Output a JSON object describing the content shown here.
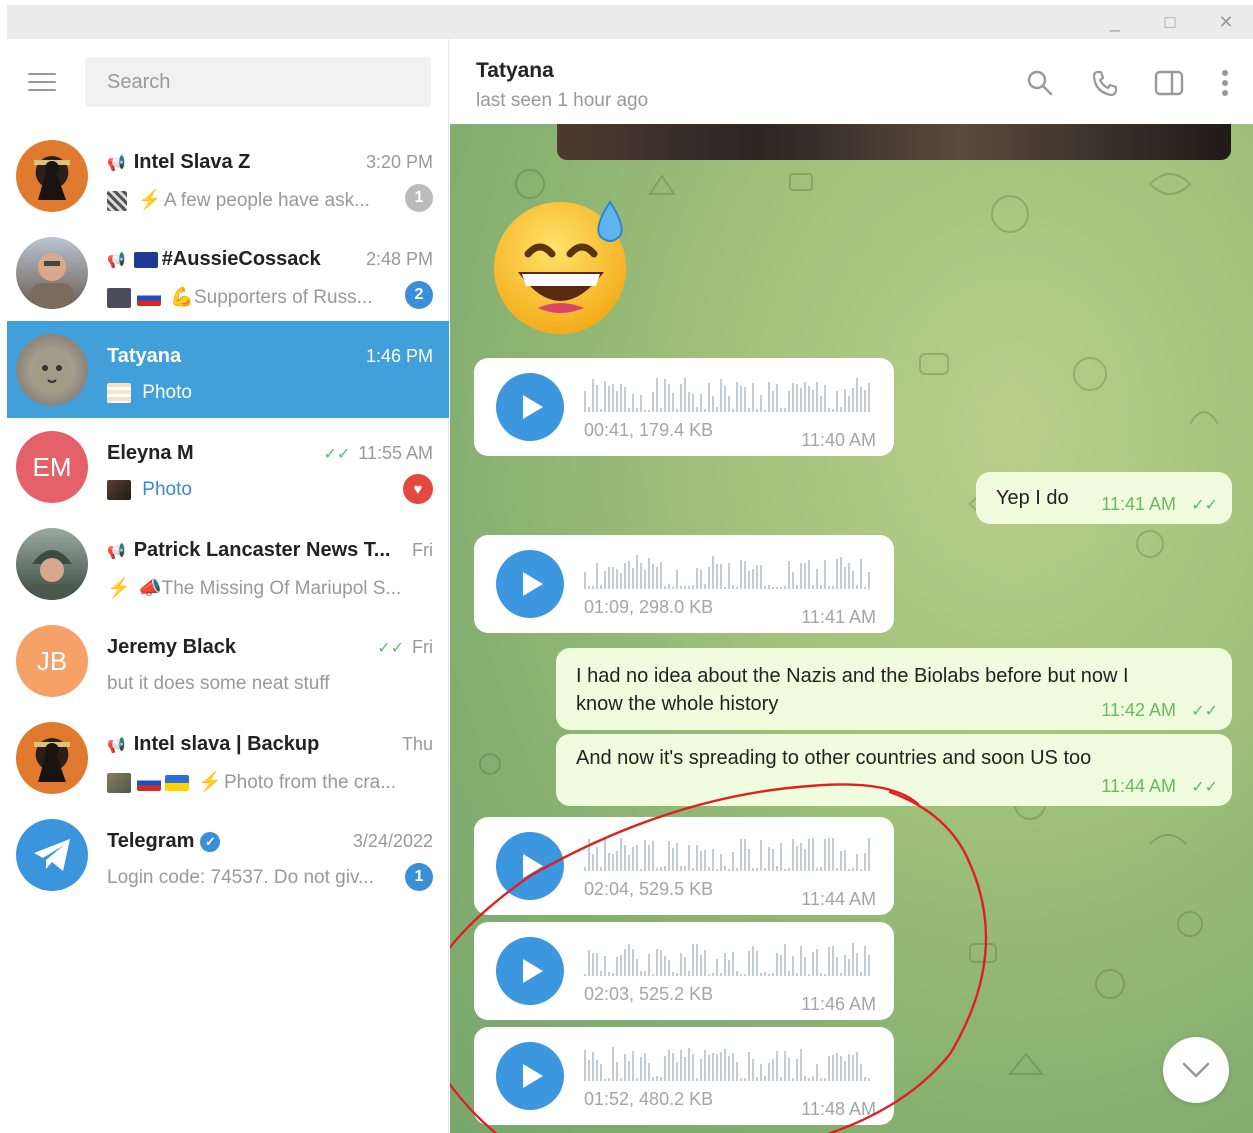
{
  "window": {
    "controls": {
      "minimize": "_",
      "maximize": "□",
      "close": "✕"
    }
  },
  "sidebar": {
    "search_placeholder": "Search",
    "chats": [
      {
        "name": "Intel Slava Z",
        "time": "3:20 PM",
        "preview": "A few people have ask...",
        "badge": "1",
        "channel": true,
        "avatar_color": "#c7682c"
      },
      {
        "name": "#AussieCossack",
        "time": "2:48 PM",
        "preview": "Supporters of Russ...",
        "badge": "2",
        "channel": true,
        "avatar_color": "#6a5a50"
      },
      {
        "name": "Tatyana",
        "time": "1:46 PM",
        "preview": "Photo",
        "badge": "",
        "channel": false,
        "active": true,
        "avatar_color": "#8a8a7a"
      },
      {
        "name": "Eleyna M",
        "time": "11:55 AM",
        "preview": "Photo",
        "badge": "",
        "channel": false,
        "avatar_initials": "EM",
        "avatar_color": "#e4616a"
      },
      {
        "name": "Patrick Lancaster News T...",
        "time": "Fri",
        "preview": "The Missing Of Mariupol S...",
        "badge": "",
        "channel": true,
        "avatar_color": "#4c5d52"
      },
      {
        "name": "Jeremy Black",
        "time": "Fri",
        "preview": "but it does some neat stuff",
        "badge": "",
        "channel": false,
        "avatar_initials": "JB",
        "avatar_color": "#f5a167"
      },
      {
        "name": "Intel slava | Backup",
        "time": "Thu",
        "preview": "Photo from the cra...",
        "badge": "",
        "channel": true,
        "avatar_color": "#c7682c"
      },
      {
        "name": "Telegram",
        "time": "3/24/2022",
        "preview": "Login code: 74537. Do not giv...",
        "badge": "1",
        "channel": false,
        "avatar_color": "#3a95dc"
      }
    ]
  },
  "header": {
    "name": "Tatyana",
    "status": "last seen 1 hour ago",
    "icons": [
      "search-icon",
      "phone-icon",
      "sidebar-toggle-icon",
      "more-icon"
    ]
  },
  "messages": {
    "voice_1": {
      "meta": "00:41, 179.4 KB",
      "time": "11:40 AM"
    },
    "out_1": {
      "text": "Yep I do",
      "time": "11:41 AM"
    },
    "voice_2": {
      "meta": "01:09, 298.0 KB",
      "time": "11:41 AM"
    },
    "out_2": {
      "text": "I had no idea about the Nazis and the Biolabs before but now I know the whole history",
      "time": "11:42 AM"
    },
    "out_3": {
      "text": "And now it's spreading to other countries and soon US too",
      "time": "11:44 AM"
    },
    "voice_3": {
      "meta": "02:04, 529.5 KB",
      "time": "11:44 AM"
    },
    "voice_4": {
      "meta": "02:03, 525.2 KB",
      "time": "11:46 AM"
    },
    "voice_5": {
      "meta": "01:52, 480.2 KB",
      "time": "11:48 AM"
    }
  },
  "colors": {
    "accent": "#419fd9",
    "outgoing_bubble": "#effdde",
    "annotation": "#e02020"
  }
}
